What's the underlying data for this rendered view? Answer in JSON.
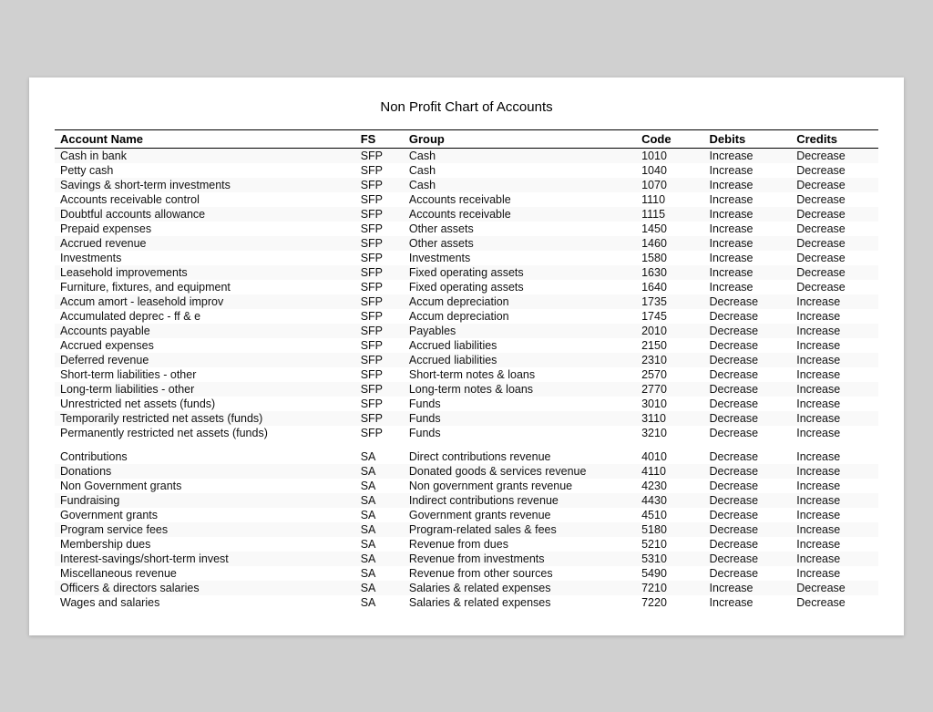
{
  "title": "Non Profit Chart of Accounts",
  "columns": {
    "account_name": "Account Name",
    "fs": "FS",
    "group": "Group",
    "code": "Code",
    "debits": "Debits",
    "credits": "Credits"
  },
  "rows": [
    {
      "name": "Cash in bank",
      "fs": "SFP",
      "group": "Cash",
      "code": "1010",
      "debits": "Increase",
      "credits": "Decrease"
    },
    {
      "name": "Petty cash",
      "fs": "SFP",
      "group": "Cash",
      "code": "1040",
      "debits": "Increase",
      "credits": "Decrease"
    },
    {
      "name": "Savings & short-term investments",
      "fs": "SFP",
      "group": "Cash",
      "code": "1070",
      "debits": "Increase",
      "credits": "Decrease"
    },
    {
      "name": "Accounts receivable control",
      "fs": "SFP",
      "group": "Accounts receivable",
      "code": "1110",
      "debits": "Increase",
      "credits": "Decrease"
    },
    {
      "name": "Doubtful accounts allowance",
      "fs": "SFP",
      "group": "Accounts receivable",
      "code": "1115",
      "debits": "Increase",
      "credits": "Decrease"
    },
    {
      "name": "Prepaid expenses",
      "fs": "SFP",
      "group": "Other assets",
      "code": "1450",
      "debits": "Increase",
      "credits": "Decrease"
    },
    {
      "name": "Accrued revenue",
      "fs": "SFP",
      "group": "Other assets",
      "code": "1460",
      "debits": "Increase",
      "credits": "Decrease"
    },
    {
      "name": "Investments",
      "fs": "SFP",
      "group": "Investments",
      "code": "1580",
      "debits": "Increase",
      "credits": "Decrease"
    },
    {
      "name": "Leasehold improvements",
      "fs": "SFP",
      "group": "Fixed operating assets",
      "code": "1630",
      "debits": "Increase",
      "credits": "Decrease"
    },
    {
      "name": "Furniture, fixtures, and equipment",
      "fs": "SFP",
      "group": "Fixed operating assets",
      "code": "1640",
      "debits": "Increase",
      "credits": "Decrease"
    },
    {
      "name": "Accum amort - leasehold improv",
      "fs": "SFP",
      "group": "Accum depreciation",
      "code": "1735",
      "debits": "Decrease",
      "credits": "Increase"
    },
    {
      "name": "Accumulated deprec - ff & e",
      "fs": "SFP",
      "group": "Accum depreciation",
      "code": "1745",
      "debits": "Decrease",
      "credits": "Increase"
    },
    {
      "name": "Accounts payable",
      "fs": "SFP",
      "group": "Payables",
      "code": "2010",
      "debits": "Decrease",
      "credits": "Increase"
    },
    {
      "name": "Accrued expenses",
      "fs": "SFP",
      "group": "Accrued liabilities",
      "code": "2150",
      "debits": "Decrease",
      "credits": "Increase"
    },
    {
      "name": "Deferred revenue",
      "fs": "SFP",
      "group": "Accrued liabilities",
      "code": "2310",
      "debits": "Decrease",
      "credits": "Increase"
    },
    {
      "name": "Short-term liabilities - other",
      "fs": "SFP",
      "group": "Short-term notes & loans",
      "code": "2570",
      "debits": "Decrease",
      "credits": "Increase"
    },
    {
      "name": "Long-term liabilities - other",
      "fs": "SFP",
      "group": "Long-term notes & loans",
      "code": "2770",
      "debits": "Decrease",
      "credits": "Increase"
    },
    {
      "name": "Unrestricted net assets (funds)",
      "fs": "SFP",
      "group": "Funds",
      "code": "3010",
      "debits": "Decrease",
      "credits": "Increase"
    },
    {
      "name": "Temporarily restricted  net assets (funds)",
      "fs": "SFP",
      "group": "Funds",
      "code": "3110",
      "debits": "Decrease",
      "credits": "Increase"
    },
    {
      "name": "Permanently restricted net assets (funds)",
      "fs": "SFP",
      "group": "Funds",
      "code": "3210",
      "debits": "Decrease",
      "credits": "Increase"
    },
    {
      "name": "",
      "fs": "",
      "group": "",
      "code": "",
      "debits": "",
      "credits": "",
      "spacer": true
    },
    {
      "name": "Contributions",
      "fs": "SA",
      "group": "Direct contributions revenue",
      "code": "4010",
      "debits": "Decrease",
      "credits": "Increase"
    },
    {
      "name": "Donations",
      "fs": "SA",
      "group": "Donated goods & services revenue",
      "code": "4110",
      "debits": "Decrease",
      "credits": "Increase"
    },
    {
      "name": "Non Government grants",
      "fs": "SA",
      "group": "Non government grants revenue",
      "code": "4230",
      "debits": "Decrease",
      "credits": "Increase"
    },
    {
      "name": "Fundraising",
      "fs": "SA",
      "group": "Indirect contributions revenue",
      "code": "4430",
      "debits": "Decrease",
      "credits": "Increase"
    },
    {
      "name": "Government grants",
      "fs": "SA",
      "group": "Government grants revenue",
      "code": "4510",
      "debits": "Decrease",
      "credits": "Increase"
    },
    {
      "name": "Program service fees",
      "fs": "SA",
      "group": "Program-related sales & fees",
      "code": "5180",
      "debits": "Decrease",
      "credits": "Increase"
    },
    {
      "name": "Membership dues",
      "fs": "SA",
      "group": "Revenue from dues",
      "code": "5210",
      "debits": "Decrease",
      "credits": "Increase"
    },
    {
      "name": "Interest-savings/short-term invest",
      "fs": "SA",
      "group": "Revenue from investments",
      "code": "5310",
      "debits": "Decrease",
      "credits": "Increase"
    },
    {
      "name": "Miscellaneous revenue",
      "fs": "SA",
      "group": "Revenue from other sources",
      "code": "5490",
      "debits": "Decrease",
      "credits": "Increase"
    },
    {
      "name": "Officers & directors salaries",
      "fs": "SA",
      "group": "Salaries & related expenses",
      "code": "7210",
      "debits": "Increase",
      "credits": "Decrease"
    },
    {
      "name": "Wages and salaries",
      "fs": "SA",
      "group": "Salaries & related expenses",
      "code": "7220",
      "debits": "Increase",
      "credits": "Decrease"
    }
  ]
}
